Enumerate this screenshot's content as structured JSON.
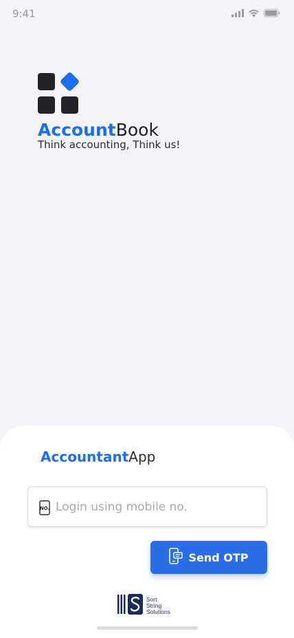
{
  "status_bar": {
    "time": "9:41"
  },
  "brand": {
    "name_primary": "Account",
    "name_secondary": "Book",
    "tagline": "Think accounting, Think us!"
  },
  "sheet": {
    "app_title_primary": "Accountant",
    "app_title_secondary": "App",
    "mobile_input": {
      "value": "",
      "placeholder": "Login using mobile no."
    },
    "send_otp_label": "Send OTP"
  },
  "footer": {
    "company_line1": "Sort",
    "company_line2": "String",
    "company_line3": "Solutions"
  },
  "colors": {
    "accent": "#1a6ff0",
    "button": "#2b6de8",
    "background": "#f3f4fa",
    "dark": "#222326"
  },
  "icons": {
    "signal": "cellular-signal-icon",
    "wifi": "wifi-icon",
    "battery": "battery-icon",
    "mobile": "mobile-number-icon",
    "otp": "phone-otp-icon"
  }
}
